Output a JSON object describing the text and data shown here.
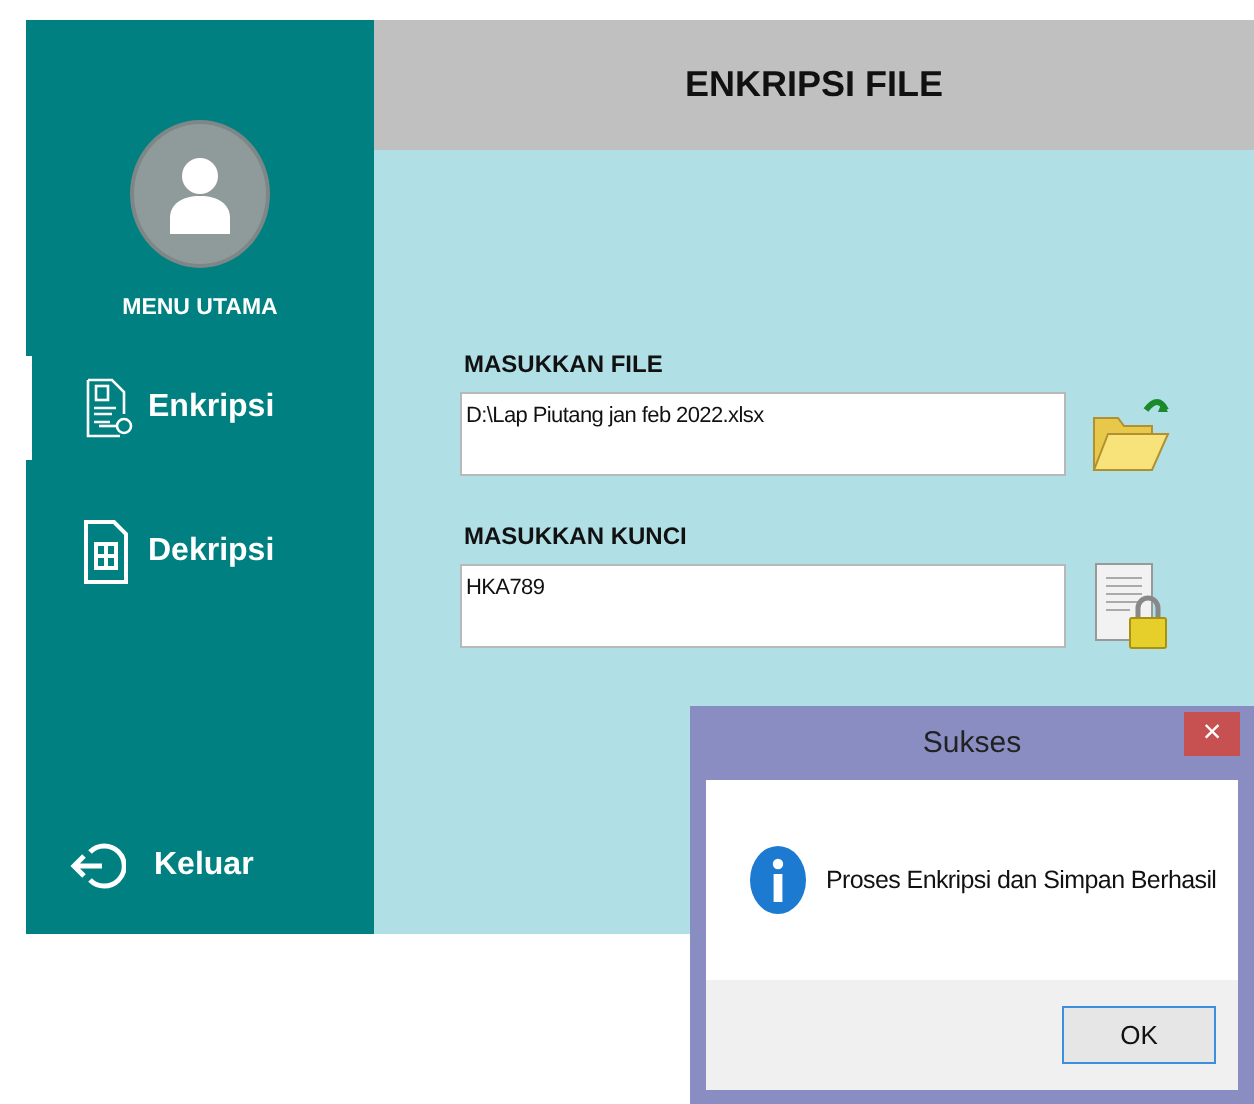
{
  "sidebar": {
    "heading": "MENU UTAMA",
    "items": [
      {
        "label": "Enkripsi",
        "kind": "encrypt",
        "selected": true
      },
      {
        "label": "Dekripsi",
        "kind": "decrypt",
        "selected": false
      }
    ],
    "exit": "Keluar"
  },
  "header": {
    "title": "ENKRIPSI FILE"
  },
  "fields": [
    {
      "label": "MASUKKAN FILE",
      "value": "D:\\Lap Piutang jan feb 2022.xlsx",
      "kind": "file"
    },
    {
      "label": "MASUKKAN KUNCI",
      "value": "HKA789",
      "kind": "key"
    }
  ],
  "dialog": {
    "title": "Sukses",
    "close": "×",
    "message": "Proses Enkripsi dan Simpan Berhasil",
    "button": "OK"
  }
}
